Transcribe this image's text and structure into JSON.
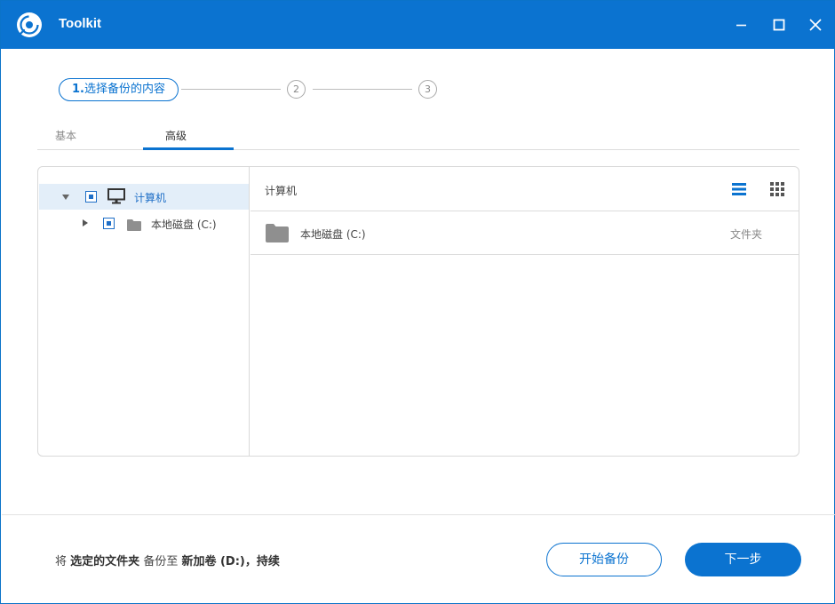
{
  "window": {
    "title": "Toolkit",
    "accent_color": "#0b73d0",
    "logo_icon": "backup-disc-logo",
    "controls": [
      "minimize-icon",
      "maximize-icon",
      "close-icon"
    ]
  },
  "stepper": {
    "step1_number": "1.",
    "step1_label": "选择备份的内容",
    "step2": "2",
    "step3": "3"
  },
  "tabs": {
    "basic": "基本",
    "advanced": "高级",
    "active": "advanced"
  },
  "tree": {
    "root": {
      "label": "计算机",
      "icon": "monitor-icon",
      "expanded": true,
      "checked": true
    },
    "children": [
      {
        "label": "本地磁盘 (C:)",
        "icon": "folder-icon",
        "expanded": false,
        "checked": true
      }
    ]
  },
  "content": {
    "path": "计算机",
    "view_modes": [
      "list-view-icon",
      "grid-view-icon"
    ],
    "items": [
      {
        "name": "本地磁盘 (C:)",
        "type": "文件夹",
        "icon": "folder-icon"
      }
    ]
  },
  "footer": {
    "summary_prefix": "将",
    "summary_source": "选定的文件夹",
    "summary_middle": "备份至",
    "summary_target": "新加卷 (D:)",
    "summary_suffix": "，持续",
    "start_button": "开始备份",
    "next_button": "下一步"
  }
}
